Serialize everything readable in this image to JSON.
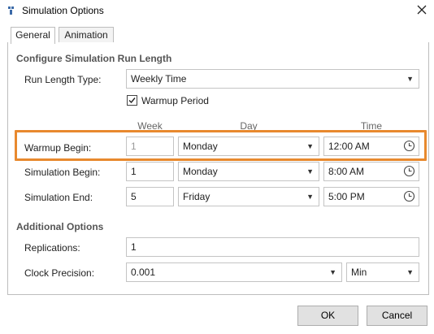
{
  "window": {
    "title": "Simulation Options",
    "app_icon": "simulation-app-icon",
    "close_icon": "close-icon"
  },
  "tabs": [
    {
      "label": "General",
      "active": true
    },
    {
      "label": "Animation",
      "active": false
    }
  ],
  "run_length": {
    "section_title": "Configure Simulation Run Length",
    "type_label": "Run Length Type:",
    "type_value": "Weekly Time",
    "warmup_checkbox_label": "Warmup Period",
    "warmup_checked": true
  },
  "columns": {
    "week": "Week",
    "day": "Day",
    "time": "Time"
  },
  "rows": [
    {
      "label": "Warmup Begin:",
      "week": "1",
      "day": "Monday",
      "time": "12:00 AM",
      "week_disabled": true,
      "highlighted": true
    },
    {
      "label": "Simulation Begin:",
      "week": "1",
      "day": "Monday",
      "time": "8:00 AM"
    },
    {
      "label": "Simulation End:",
      "week": "5",
      "day": "Friday",
      "time": "5:00 PM"
    }
  ],
  "additional": {
    "section_title": "Additional Options",
    "replications_label": "Replications:",
    "replications_value": "1",
    "clock_precision_label": "Clock Precision:",
    "clock_precision_value": "0.001",
    "clock_unit_value": "Min"
  },
  "buttons": {
    "ok": "OK",
    "cancel": "Cancel"
  },
  "colors": {
    "highlight": "#e8892e",
    "border": "#bdbdbd"
  }
}
